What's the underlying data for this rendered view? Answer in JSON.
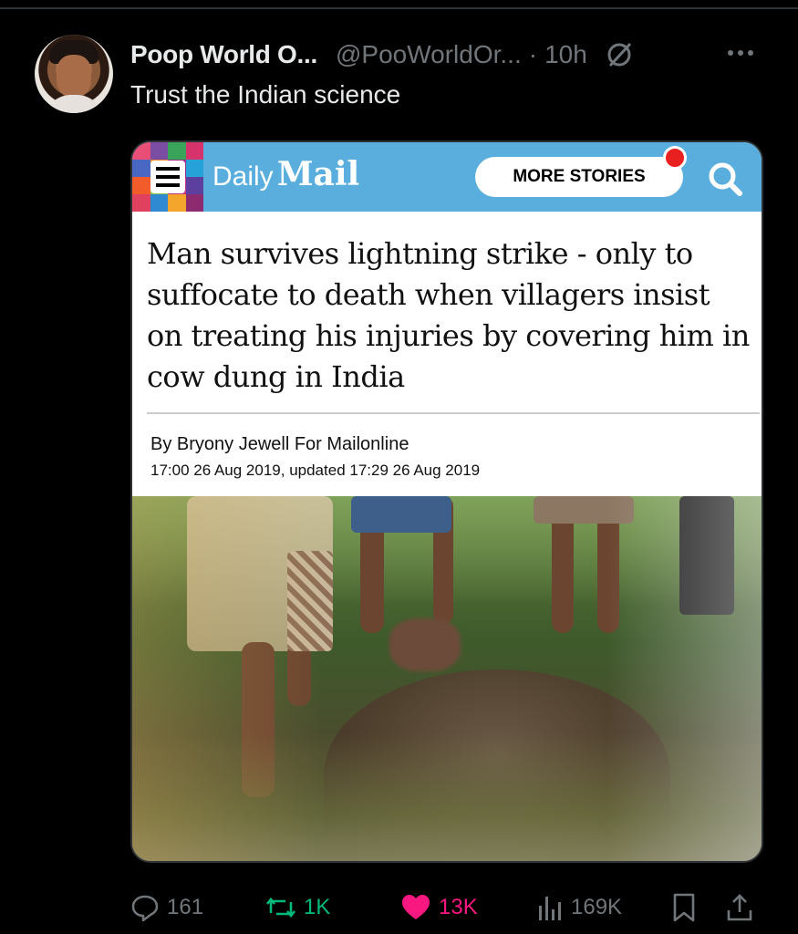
{
  "tweet": {
    "author_name": "Poop World O...",
    "author_handle": "@PooWorldOr...",
    "separator": "·",
    "time": "10h",
    "text": "Trust the Indian science"
  },
  "article": {
    "brand_daily": "Daily",
    "brand_mail": "Mail",
    "more_stories": "MORE STORIES",
    "headline": "Man survives lightning strike - only to suffocate to death when villagers insist on treating his injuries by covering him in cow dung in India",
    "byline": "By Bryony Jewell For Mailonline",
    "dateline": "17:00 26 Aug 2019, updated 17:29 26 Aug 2019"
  },
  "actions": {
    "replies": "161",
    "reposts": "1K",
    "likes": "13K",
    "views": "169K"
  },
  "colors": {
    "background": "#000000",
    "muted": "#71767b",
    "repost": "#00ba7c",
    "like": "#f91880",
    "dailymail_blue": "#5aaedd"
  },
  "icons": [
    "grok-icon",
    "more-icon",
    "hamburger-icon",
    "search-icon",
    "reply-icon",
    "repost-icon",
    "heart-icon",
    "views-icon",
    "bookmark-icon",
    "share-icon"
  ]
}
